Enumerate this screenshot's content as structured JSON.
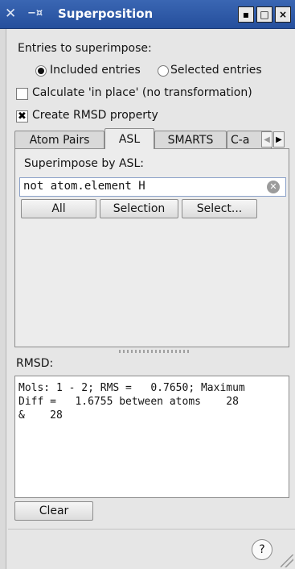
{
  "window": {
    "title": "Superposition",
    "icons": {
      "app": "x-icon",
      "pin": "pin-icon"
    },
    "buttons": {
      "minimize": "▪",
      "maximize": "□",
      "close": "×"
    }
  },
  "entries": {
    "label": "Entries to superimpose:",
    "options": [
      {
        "label": "Included entries",
        "selected": true
      },
      {
        "label": "Selected entries",
        "selected": false
      }
    ]
  },
  "checkboxes": {
    "in_place": {
      "label": "Calculate 'in place' (no transformation)",
      "checked": false
    },
    "rmsd_property": {
      "label": "Create RMSD property",
      "checked": true
    }
  },
  "tabs": [
    {
      "label": "Atom Pairs",
      "active": false
    },
    {
      "label": "ASL",
      "active": true
    },
    {
      "label": "SMARTS",
      "active": false
    },
    {
      "label": "C-a",
      "active": false
    }
  ],
  "asl": {
    "label": "Superimpose by ASL:",
    "value": "not atom.element H",
    "buttons": {
      "all": "All",
      "selection": "Selection",
      "select": "Select..."
    }
  },
  "rmsd": {
    "label": "RMSD:",
    "output": "Mols: 1 - 2; RMS =   0.7650; Maximum\nDiff =   1.6755 between atoms    28\n&    28",
    "clear_button": "Clear"
  },
  "footer": {
    "help": "?"
  }
}
